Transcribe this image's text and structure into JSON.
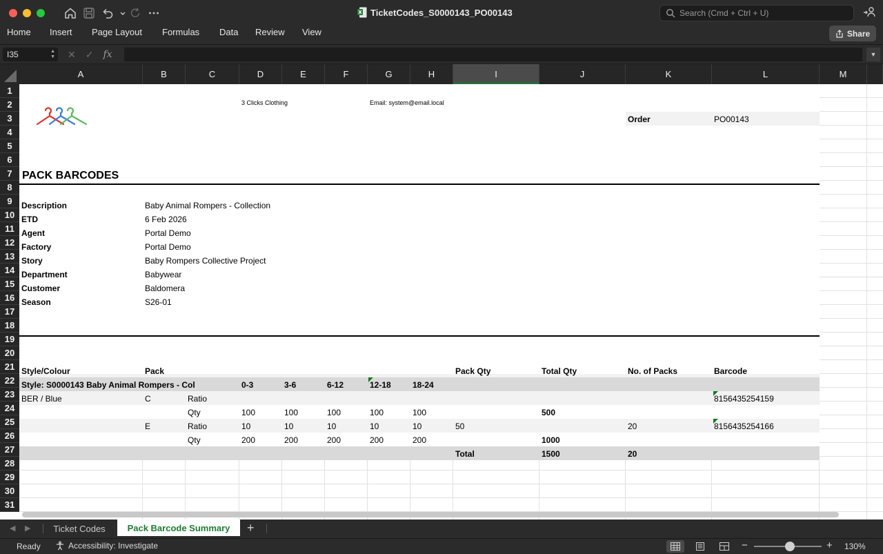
{
  "window": {
    "title": "TicketCodes_S0000143_PO00143"
  },
  "search": {
    "placeholder": "Search (Cmd + Ctrl + U)"
  },
  "ribbon": {
    "tabs": [
      "Home",
      "Insert",
      "Page Layout",
      "Formulas",
      "Data",
      "Review",
      "View"
    ],
    "share_label": "Share"
  },
  "formula_bar": {
    "name_box": "I35",
    "fx_label": "fx",
    "formula": ""
  },
  "grid": {
    "columns": [
      "A",
      "B",
      "C",
      "D",
      "E",
      "F",
      "G",
      "H",
      "I",
      "J",
      "K",
      "L",
      "M"
    ],
    "selected_column": "I",
    "rows": [
      "1",
      "2",
      "3",
      "4",
      "5",
      "6",
      "7",
      "8",
      "9",
      "10",
      "11",
      "12",
      "13",
      "14",
      "15",
      "16",
      "17",
      "18",
      "19",
      "20",
      "21",
      "22",
      "23",
      "24",
      "25",
      "26",
      "27",
      "28",
      "29",
      "30",
      "31"
    ]
  },
  "sheet": {
    "company": "3 Clicks Clothing",
    "email": "Email: system@email.local",
    "order_label": "Order",
    "order_value": "PO00143",
    "heading": "PACK BARCODES",
    "details": [
      {
        "label": "Description",
        "value": "Baby Animal Rompers - Collection"
      },
      {
        "label": "ETD",
        "value": "6 Feb 2026"
      },
      {
        "label": "Agent",
        "value": "Portal Demo"
      },
      {
        "label": "Factory",
        "value": "Portal Demo"
      },
      {
        "label": "Story",
        "value": "Baby Rompers Collective Project"
      },
      {
        "label": "Department",
        "value": "Babywear"
      },
      {
        "label": "Customer",
        "value": "Baldomera"
      },
      {
        "label": "Season",
        "value": "S26-01"
      }
    ],
    "table": {
      "headers": {
        "style_colour": "Style/Colour",
        "pack": "Pack",
        "pack_qty": "Pack Qty",
        "total_qty": "Total Qty",
        "no_of_packs": "No. of Packs",
        "barcode": "Barcode"
      },
      "style_row": "Style: S0000143 Baby Animal Rompers - Col",
      "sizes": [
        "0-3",
        "3-6",
        "6-12",
        "12-18",
        "18-24"
      ],
      "packs": [
        {
          "colour": "BER / Blue",
          "pack": "C",
          "ratio_label": "Ratio",
          "ratio": [
            "",
            "",
            "",
            "",
            ""
          ],
          "pack_qty": "",
          "no_of_packs": "",
          "barcode": "8156435254159",
          "qty_label": "Qty",
          "qty": [
            "100",
            "100",
            "100",
            "100",
            "100"
          ],
          "total_qty": "500"
        },
        {
          "colour": "",
          "pack": "E",
          "ratio_label": "Ratio",
          "ratio": [
            "10",
            "10",
            "10",
            "10",
            "10"
          ],
          "pack_qty": "50",
          "no_of_packs": "20",
          "barcode": "8156435254166",
          "qty_label": "Qty",
          "qty": [
            "200",
            "200",
            "200",
            "200",
            "200"
          ],
          "total_qty": "1000"
        }
      ],
      "total_label": "Total",
      "total_qty": "1500",
      "total_packs": "20"
    }
  },
  "sheet_tabs": [
    {
      "label": "Ticket Codes",
      "active": false
    },
    {
      "label": "Pack Barcode Summary",
      "active": true
    }
  ],
  "status": {
    "ready": "Ready",
    "accessibility": "Accessibility: Investigate",
    "zoom": "130%"
  },
  "colors": {
    "accent": "#1e7b34",
    "logo_red": "#d9342b",
    "logo_blue": "#3a7bd5",
    "logo_green": "#5cb85c"
  }
}
